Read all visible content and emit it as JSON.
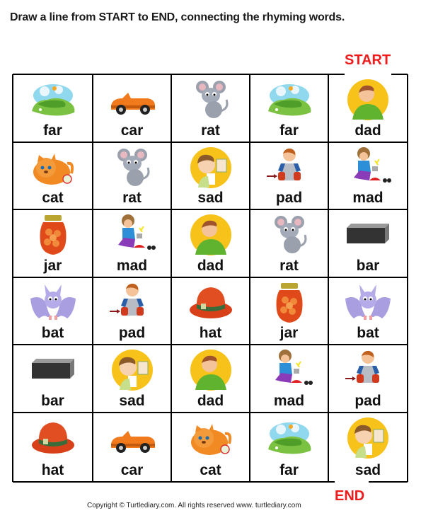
{
  "instructions": "Draw a line from START to END, connecting the rhyming words.",
  "start_label": "START",
  "end_label": "END",
  "copyright": "Copyright © Turtlediary.com. All rights reserved   www. turtlediary.com",
  "maze": {
    "rows": 6,
    "cols": 5,
    "start_cell": {
      "row": 0,
      "col": 4
    },
    "end_cell": {
      "row": 5,
      "col": 4
    },
    "cells": [
      [
        {
          "word": "far",
          "icon": "golf-course"
        },
        {
          "word": "car",
          "icon": "car"
        },
        {
          "word": "rat",
          "icon": "rat"
        },
        {
          "word": "far",
          "icon": "golf-course"
        },
        {
          "word": "dad",
          "icon": "dad"
        }
      ],
      [
        {
          "word": "cat",
          "icon": "cat"
        },
        {
          "word": "rat",
          "icon": "rat"
        },
        {
          "word": "sad",
          "icon": "sad-boy"
        },
        {
          "word": "pad",
          "icon": "elbow-pad"
        },
        {
          "word": "mad",
          "icon": "mad-boy"
        }
      ],
      [
        {
          "word": "jar",
          "icon": "jar"
        },
        {
          "word": "mad",
          "icon": "mad-boy"
        },
        {
          "word": "dad",
          "icon": "dad"
        },
        {
          "word": "rat",
          "icon": "rat"
        },
        {
          "word": "bar",
          "icon": "metal-bar"
        }
      ],
      [
        {
          "word": "bat",
          "icon": "bat"
        },
        {
          "word": "pad",
          "icon": "elbow-pad"
        },
        {
          "word": "hat",
          "icon": "hat"
        },
        {
          "word": "jar",
          "icon": "jar"
        },
        {
          "word": "bat",
          "icon": "bat"
        }
      ],
      [
        {
          "word": "bar",
          "icon": "metal-bar"
        },
        {
          "word": "sad",
          "icon": "sad-boy"
        },
        {
          "word": "dad",
          "icon": "dad"
        },
        {
          "word": "mad",
          "icon": "mad-boy"
        },
        {
          "word": "pad",
          "icon": "elbow-pad"
        }
      ],
      [
        {
          "word": "hat",
          "icon": "hat"
        },
        {
          "word": "car",
          "icon": "car"
        },
        {
          "word": "cat",
          "icon": "cat"
        },
        {
          "word": "far",
          "icon": "golf-course"
        },
        {
          "word": "sad",
          "icon": "sad-boy"
        }
      ]
    ]
  }
}
